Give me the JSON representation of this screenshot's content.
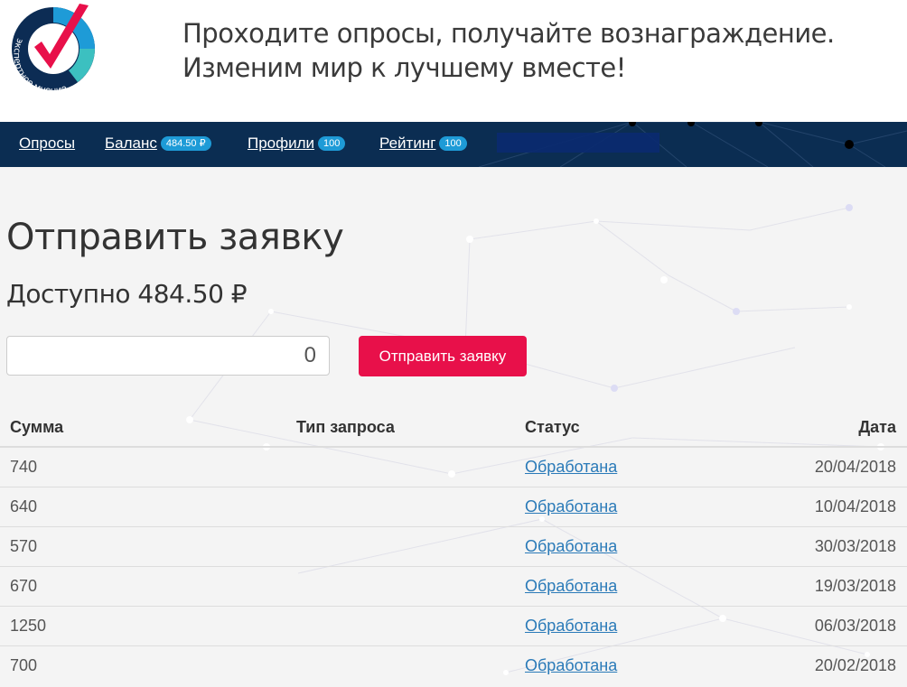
{
  "header": {
    "logo_text": "экспертное мнение",
    "tagline_line1": "Проходите опросы, получайте вознаграждение.",
    "tagline_line2": "Изменим мир к лучшему вместе!"
  },
  "nav": {
    "items": [
      {
        "label": "Опросы",
        "badge": ""
      },
      {
        "label": "Баланс",
        "badge": "484.50 ₽"
      },
      {
        "label": "Профили",
        "badge": "100"
      },
      {
        "label": "Рейтинг",
        "badge": "100"
      }
    ]
  },
  "main": {
    "title": "Отправить заявку",
    "available": "Доступно 484.50 ₽",
    "amount_value": "0",
    "submit_label": "Отправить заявку"
  },
  "table": {
    "headers": [
      "Сумма",
      "Тип запроса",
      "Статус",
      "Дата"
    ],
    "rows": [
      {
        "sum": "740",
        "type": "",
        "status": "Обработана",
        "date": "20/04/2018"
      },
      {
        "sum": "640",
        "type": "",
        "status": "Обработана",
        "date": "10/04/2018"
      },
      {
        "sum": "570",
        "type": "",
        "status": "Обработана",
        "date": "30/03/2018"
      },
      {
        "sum": "670",
        "type": "",
        "status": "Обработана",
        "date": "19/03/2018"
      },
      {
        "sum": "1250",
        "type": "",
        "status": "Обработана",
        "date": "06/03/2018"
      },
      {
        "sum": "700",
        "type": "",
        "status": "Обработана",
        "date": "20/02/2018"
      }
    ]
  },
  "colors": {
    "navbar": "#0b2d52",
    "accent": "#e8104a",
    "badge": "#1e9bd7",
    "link": "#2a7ab8"
  }
}
